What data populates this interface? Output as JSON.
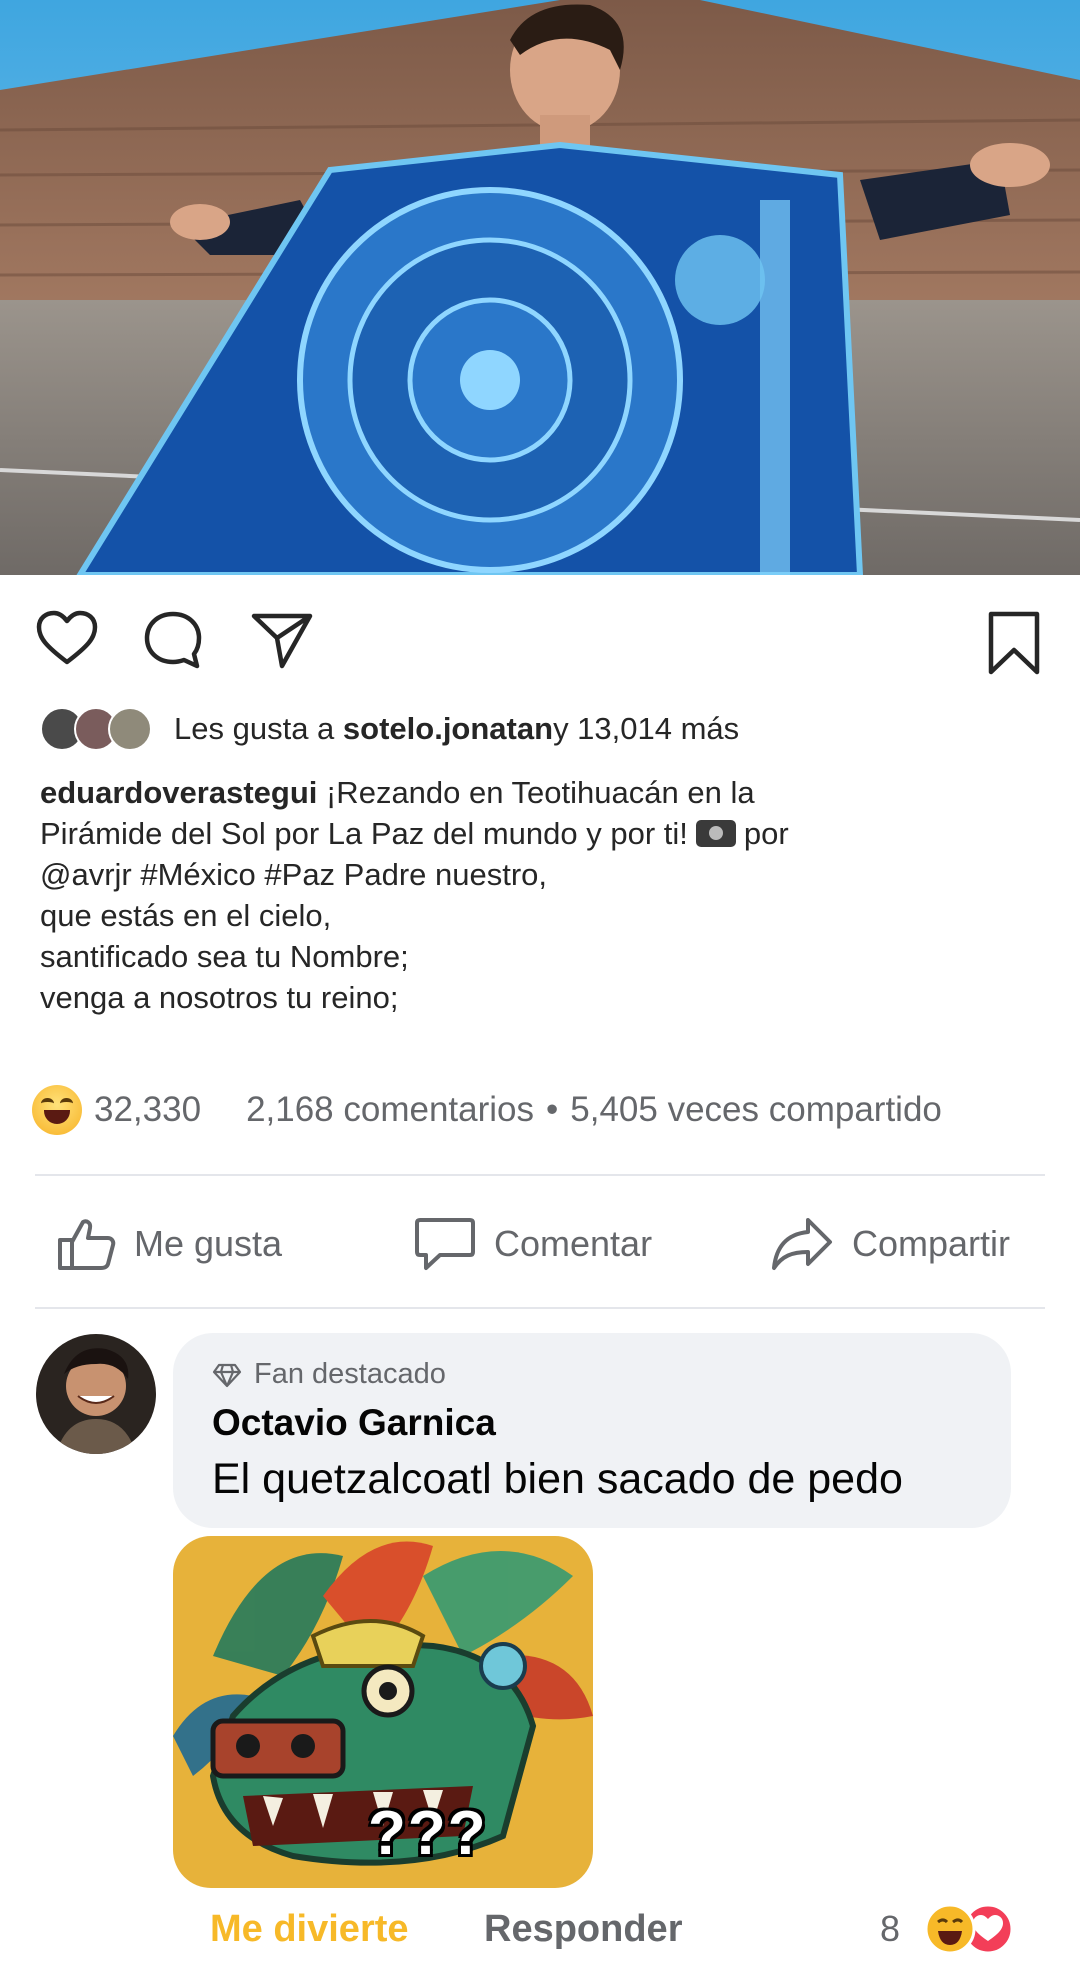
{
  "instagram_post": {
    "likes": {
      "prefix": "Les gusta a ",
      "user": "sotelo.jonatan",
      "suffix": " y 13,014 más"
    },
    "caption": {
      "username": "eduardoverastegui",
      "line1_text": " ¡Rezando en Teotihuacán en la",
      "line2_before_camera": "Pirámide del Sol por La Paz del mundo y por ti!",
      "line2_after_camera": "por",
      "line3": "@avrjr #México #Paz  Padre nuestro,",
      "line4": "que estás en el cielo,",
      "line5": "santificado sea tu Nombre;",
      "line6": "venga a nosotros tu reino;"
    }
  },
  "facebook_post": {
    "reaction_count": "32,330",
    "comments_count": "2,168 comentarios",
    "separator": "•",
    "shares_count": "5,405 veces compartido",
    "actions": {
      "like": "Me gusta",
      "comment": "Comentar",
      "share": "Compartir"
    }
  },
  "comment": {
    "badge": "Fan destacado",
    "author": "Octavio Garnica",
    "text": "El quetzalcoatl bien sacado de pedo",
    "sticker_text": "???",
    "reaction_label": "Me divierte",
    "reply_label": "Responder",
    "reaction_count": "8"
  },
  "colors": {
    "sky": "#4ab1e6",
    "pyramid": "#8a6450",
    "poncho": "#1452a8",
    "facebook_gray": "#65676b",
    "haha_yellow": "#f7b928",
    "bubble_bg": "#f0f2f5"
  },
  "icons": [
    "heart-icon",
    "comment-icon",
    "send-icon",
    "bookmark-icon",
    "haha-emoji-icon",
    "thumbs-up-icon",
    "comment-bubble-icon",
    "share-arrow-icon",
    "diamond-icon",
    "love-emoji-icon"
  ]
}
